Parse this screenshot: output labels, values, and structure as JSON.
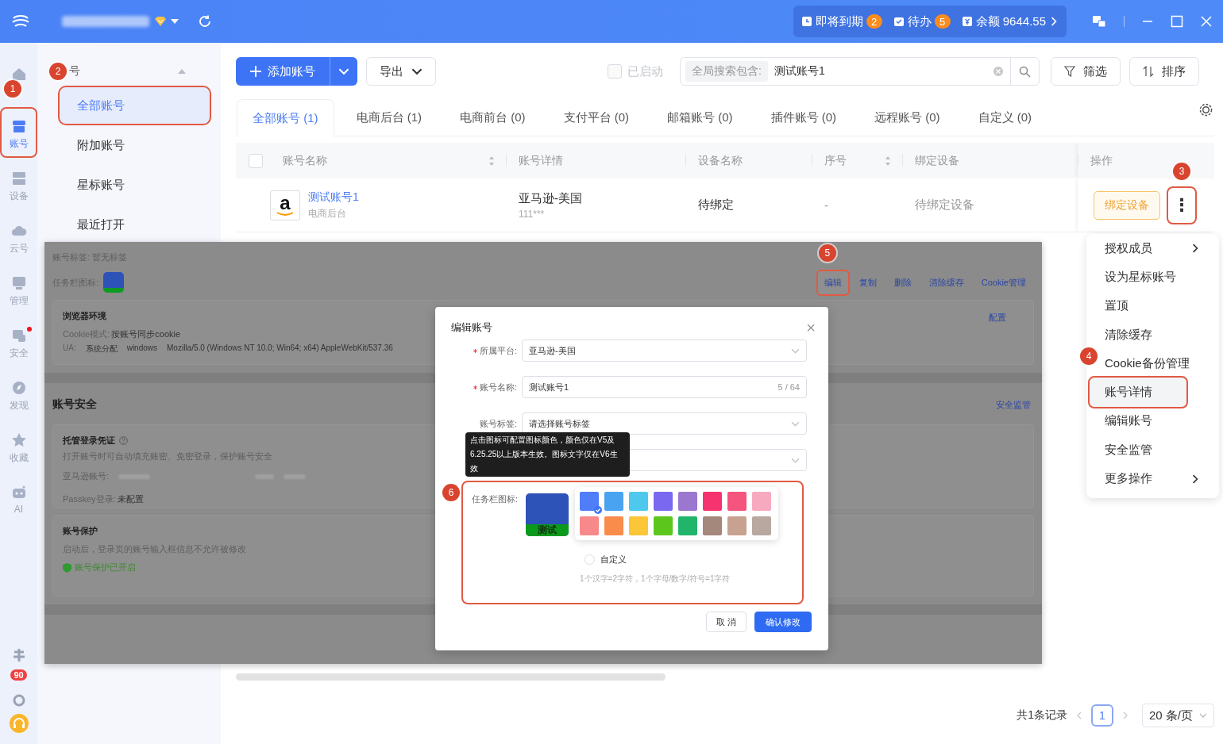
{
  "topbar": {
    "stats": [
      {
        "kind": "expiring",
        "label": "即将到期",
        "count": "2"
      },
      {
        "kind": "todo",
        "label": "待办",
        "count": "5"
      },
      {
        "kind": "balance",
        "label": "余额 9644.55"
      }
    ]
  },
  "rail": {
    "items": [
      {
        "kind": "home",
        "selected": false,
        "highlighted": false,
        "alert": false,
        "marker": "1"
      },
      {
        "kind": "store",
        "label": "账号",
        "selected": true,
        "highlighted": true,
        "alert": false
      },
      {
        "kind": "server",
        "label": "设备",
        "selected": false,
        "highlighted": false,
        "alert": false
      },
      {
        "kind": "cloud",
        "label": "云号",
        "selected": false,
        "highlighted": false,
        "alert": false
      },
      {
        "kind": "monitor",
        "label": "管理",
        "selected": false,
        "highlighted": false,
        "alert": false
      },
      {
        "kind": "shield",
        "label": "安全",
        "selected": false,
        "highlighted": false,
        "alert": true
      },
      {
        "kind": "compass",
        "label": "发现",
        "selected": false,
        "highlighted": false,
        "alert": false
      },
      {
        "kind": "star",
        "label": "收藏",
        "selected": false,
        "highlighted": false,
        "alert": false
      },
      {
        "kind": "robot",
        "label": "AI",
        "selected": false,
        "highlighted": false,
        "alert": false
      }
    ],
    "notification_count": "90"
  },
  "sidebar": {
    "title": "号",
    "marker": "2",
    "items": [
      {
        "label": "全部账号",
        "selected": true,
        "highlighted": true
      },
      {
        "label": "附加账号",
        "selected": false,
        "highlighted": false
      },
      {
        "label": "星标账号",
        "selected": false,
        "highlighted": false
      },
      {
        "label": "最近打开",
        "selected": false,
        "highlighted": false
      }
    ]
  },
  "toolbar": {
    "add_button": "添加账号",
    "export_button": "导出",
    "enabled_filter": {
      "label": "已启动",
      "checked": false
    },
    "search": {
      "scope": "全局搜索包含:",
      "value": "测试账号1"
    },
    "filter_button": "筛选",
    "sort_button": "排序"
  },
  "tabs": [
    {
      "label": "全部账号 (1)",
      "selected": true
    },
    {
      "label": "电商后台 (1)",
      "selected": false
    },
    {
      "label": "电商前台 (0)",
      "selected": false
    },
    {
      "label": "支付平台 (0)",
      "selected": false
    },
    {
      "label": "邮箱账号 (0)",
      "selected": false
    },
    {
      "label": "插件账号 (0)",
      "selected": false
    },
    {
      "label": "远程账号 (0)",
      "selected": false
    },
    {
      "label": "自定义 (0)",
      "selected": false
    }
  ],
  "table": {
    "select_all_checked": false,
    "columns": [
      {
        "label": "账号名称",
        "sortable": true
      },
      {
        "label": "账号详情",
        "sortable": false
      },
      {
        "label": "设备名称",
        "sortable": false
      },
      {
        "label": "序号",
        "sortable": true
      },
      {
        "label": "绑定设备",
        "sortable": false
      },
      {
        "label": "操作",
        "sortable": false
      }
    ],
    "rows": [
      {
        "logo": "a",
        "name": "测试账号1",
        "category": "电商后台",
        "platform": "亚马逊-美国",
        "account_id": "111***",
        "device": "待绑定",
        "index": "-",
        "binding": "待绑定设备",
        "action": "绑定设备",
        "more": "⋮",
        "more_marker": "3",
        "more_highlighted": true
      }
    ]
  },
  "pagination": {
    "total": "共1条记录",
    "pages": [
      {
        "label": "1",
        "selected": true
      }
    ],
    "page_size": "20 条/页"
  },
  "details": {
    "tag_line": "账号标签: 暂无标签",
    "icon_label": "任务栏图标:",
    "actions": [
      {
        "label": "编辑",
        "highlighted": true,
        "marker": "5"
      },
      {
        "label": "复制",
        "highlighted": false
      },
      {
        "label": "删除",
        "highlighted": false
      },
      {
        "label": "清除缓存",
        "highlighted": false
      },
      {
        "label": "Cookie管理",
        "highlighted": false
      }
    ],
    "browser": {
      "title": "浏览器环境",
      "link": "配置",
      "cookie_label": "Cookie模式:",
      "cookie_value": "按账号同步cookie",
      "ua_label": "UA:",
      "ua_values": [
        "系统分配",
        "windows",
        "Mozilla/5.0 (Windows NT 10.0; Win64; x64) AppleWebKit/537.36"
      ]
    },
    "security": {
      "title": "账号安全",
      "link": "安全监管",
      "credential": {
        "title": "托管登录凭证",
        "description": "打开账号时可自动填充账密、免密登录，保护账号安全",
        "account_label": "亚马逊账号:",
        "passkey_label": "Passkey登录:",
        "passkey_value": "未配置"
      },
      "protection": {
        "title": "账号保护",
        "description": "启动后，登录页的账号输入框信息不允许被修改",
        "status": "账号保护已开启"
      }
    }
  },
  "dialog": {
    "title": "编辑账号",
    "close": "×",
    "fields": [
      {
        "kind": "select",
        "label": "所属平台:",
        "required": true,
        "value": "亚马逊-美国"
      },
      {
        "kind": "input",
        "label": "账号名称:",
        "required": true,
        "value": "测试账号1",
        "counter": "5 / 64"
      },
      {
        "kind": "select",
        "label": "账号标签:",
        "required": false,
        "placeholder": "请选择账号标签"
      },
      {
        "kind": "select",
        "required": false
      }
    ],
    "tooltip": "点击图标可配置图标颜色，颜色仅在V5及6.25.25以上版本生效。图标文字仅在V6生效",
    "icon_setting": {
      "label": "任务栏图标:",
      "icon_text": "测试",
      "marker": "6",
      "highlighted": true,
      "colors": [
        {
          "color": "#4f7ef8",
          "selected": true
        },
        {
          "color": "#4aa3f0",
          "selected": false
        },
        {
          "color": "#4fc8ee",
          "selected": false
        },
        {
          "color": "#7b68f0",
          "selected": false
        },
        {
          "color": "#9b77cf",
          "selected": false
        },
        {
          "color": "#f7336f",
          "selected": false
        },
        {
          "color": "#f4547e",
          "selected": false
        },
        {
          "color": "#f7a9c0",
          "selected": false
        },
        {
          "color": "#f7898a",
          "selected": false
        },
        {
          "color": "#f98c4b",
          "selected": false
        },
        {
          "color": "#fbc638",
          "selected": false
        },
        {
          "color": "#5cc61c",
          "selected": false
        },
        {
          "color": "#21b56a",
          "selected": false
        },
        {
          "color": "#a4887c",
          "selected": false
        },
        {
          "color": "#c8a290",
          "selected": false
        },
        {
          "color": "#b8a8a0",
          "selected": false
        }
      ],
      "custom_option": {
        "label": "自定义",
        "checked": false
      },
      "hint": "1个汉字=2字符，1个字母/数字/符号=1字符"
    },
    "buttons": [
      {
        "kind": "secondary",
        "label": "取 消"
      },
      {
        "kind": "primary",
        "label": "确认修改"
      }
    ]
  },
  "menu": {
    "items": [
      {
        "label": "授权成员",
        "submenu": true,
        "selected": false,
        "highlighted": false
      },
      {
        "label": "设为星标账号",
        "submenu": false,
        "selected": false,
        "highlighted": false
      },
      {
        "label": "置顶",
        "submenu": false,
        "selected": false,
        "highlighted": false
      },
      {
        "label": "清除缓存",
        "submenu": false,
        "selected": false,
        "highlighted": false
      },
      {
        "label": "Cookie备份管理",
        "submenu": false,
        "selected": false,
        "highlighted": false,
        "marker": "4"
      },
      {
        "label": "账号详情",
        "submenu": false,
        "selected": true,
        "highlighted": true
      },
      {
        "label": "编辑账号",
        "submenu": false,
        "selected": false,
        "highlighted": false
      },
      {
        "label": "安全监管",
        "submenu": false,
        "selected": false,
        "highlighted": false
      },
      {
        "label": "更多操作",
        "submenu": true,
        "selected": false,
        "highlighted": false
      }
    ]
  }
}
